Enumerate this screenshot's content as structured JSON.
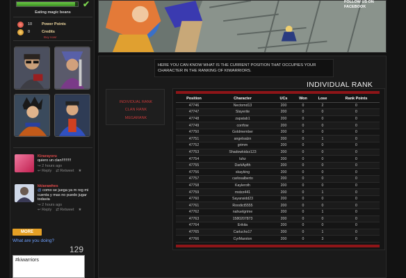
{
  "sidebar": {
    "xp_label": "Eating magic beans",
    "xp_progress": 0.95,
    "stats": [
      {
        "icon": "power-points-icon",
        "value": "10",
        "label": "Power Points",
        "color": "#e0534a"
      },
      {
        "icon": "credits-icon",
        "value": "0",
        "label": "Credits",
        "color": "#e6a12b"
      }
    ],
    "credits_sub": "Buy now!",
    "tweets": [
      {
        "user": "Kirarayoru",
        "text": "quiero un clan!!!!!!!!!",
        "time": "2 hours ago",
        "reply": "Reply",
        "retweet": "Retweet"
      },
      {
        "user": "kkiarawhes",
        "mention": "@",
        "text": "como se juega ya m reg mi cuenta y mas no puedo jugar todavia",
        "time": "2 hours ago",
        "reply": "Reply",
        "retweet": "Retweet"
      }
    ],
    "more_label": "MORE",
    "what_doing": "What are you doing?",
    "char_count": "129",
    "tweet_input": "#kiwarriors"
  },
  "banner": {
    "follow_text": "FOLLOW US ON FACEBOOK"
  },
  "main": {
    "info_text_1": "HERE YOU CAN KNOW WHAT IS THE CURRENT POSITION THAT OCCUPIES YOUR",
    "info_text_2": "CHARACTER IN THE RANKING OF KIWARRIORS.",
    "title": "INDIVIDUAL RANK",
    "menu": [
      "INDIVIDUAL RANK",
      "CLAN RANK",
      "MEGARANK"
    ],
    "table": {
      "headers": [
        "Position",
        "Character",
        "UCs",
        "Won",
        "Lose",
        "Rank Points"
      ],
      "rows": [
        [
          "47746",
          "Nectomd13",
          "200",
          "0",
          "2",
          "0"
        ],
        [
          "47747",
          "Slayerite",
          "200",
          "0",
          "0",
          "0"
        ],
        [
          "47748",
          "zapatab1",
          "200",
          "0",
          "0",
          "0"
        ],
        [
          "47749",
          "corrfow",
          "200",
          "0",
          "0",
          "0"
        ],
        [
          "47750",
          "Goldmember",
          "200",
          "0",
          "0",
          "0"
        ],
        [
          "47751",
          "angelsalzn",
          "200",
          "0",
          "1",
          "0"
        ],
        [
          "47752",
          "grimm",
          "200",
          "0",
          "0",
          "0"
        ],
        [
          "47753",
          "Shadowkidzz123",
          "200",
          "0",
          "0",
          "0"
        ],
        [
          "47754",
          "luhz",
          "200",
          "0",
          "0",
          "0"
        ],
        [
          "47755",
          "DarkApfth",
          "200",
          "0",
          "0",
          "0"
        ],
        [
          "47756",
          "skayking",
          "200",
          "0",
          "0",
          "0"
        ],
        [
          "47757",
          "carlosalberto",
          "200",
          "0",
          "0",
          "0"
        ],
        [
          "47758",
          "Kayleroth",
          "200",
          "0",
          "0",
          "0"
        ],
        [
          "47759",
          "mstzz441",
          "200",
          "0",
          "1",
          "0"
        ],
        [
          "47760",
          "Sayansidd23",
          "200",
          "0",
          "0",
          "0"
        ],
        [
          "47761",
          "Roodict5555",
          "200",
          "0",
          "0",
          "0"
        ],
        [
          "47762",
          "nahuelgrime",
          "200",
          "0",
          "1",
          "0"
        ],
        [
          "47763",
          "1580207873",
          "200",
          "0",
          "0",
          "0"
        ],
        [
          "47764",
          "Erikita",
          "200",
          "0",
          "0",
          "0"
        ],
        [
          "47765",
          "Carlucho17",
          "200",
          "0",
          "1",
          "0"
        ],
        [
          "47766",
          "CyrMarston",
          "200",
          "0",
          "3",
          "0"
        ]
      ]
    }
  }
}
